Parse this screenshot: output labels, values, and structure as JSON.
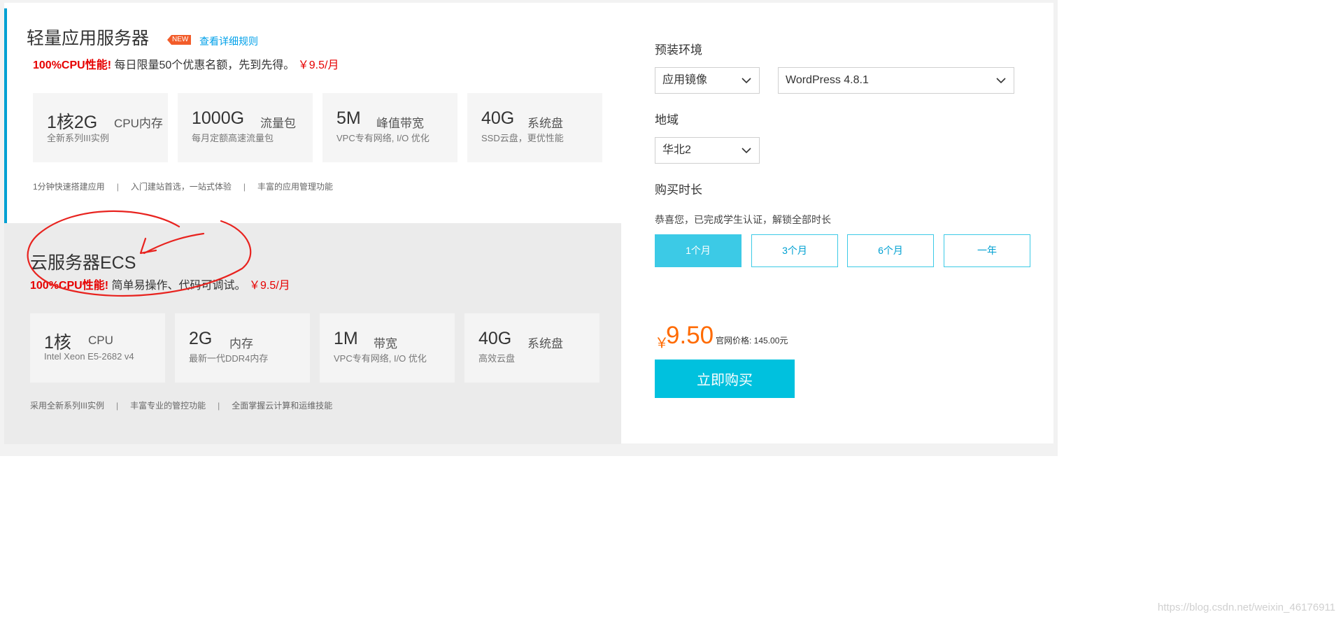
{
  "lightweight": {
    "title": "轻量应用服务器",
    "badge": "NEW",
    "rule_link": "查看详细规则",
    "promo_highlight": "100%CPU性能!",
    "promo_text": "每日限量50个优惠名额，先到先得。",
    "promo_price": "￥9.5/月",
    "specs": [
      {
        "big": "1核2G",
        "unit": "CPU内存",
        "desc": "全新系列III实例"
      },
      {
        "big": "1000G",
        "unit": "流量包",
        "desc": "每月定额高速流量包"
      },
      {
        "big": "5M",
        "unit": "峰值带宽",
        "desc": "VPC专有网络, I/O 优化"
      },
      {
        "big": "40G",
        "unit": "系统盘",
        "desc": "SSD云盘，更优性能"
      }
    ],
    "features": [
      "1分钟快速搭建应用",
      "入门建站首选，一站式体验",
      "丰富的应用管理功能"
    ],
    "feature_separator": "|"
  },
  "ecs": {
    "title": "云服务器ECS",
    "promo_highlight": "100%CPU性能!",
    "promo_text": "简单易操作、代码可调试。",
    "promo_price": "￥9.5/月",
    "specs": [
      {
        "big": "1核",
        "unit": "CPU",
        "desc": "Intel Xeon E5-2682 v4"
      },
      {
        "big": "2G",
        "unit": "内存",
        "desc": "最新一代DDR4内存"
      },
      {
        "big": "1M",
        "unit": "带宽",
        "desc": "VPC专有网络, I/O 优化"
      },
      {
        "big": "40G",
        "unit": "系统盘",
        "desc": "高效云盘"
      }
    ],
    "features": [
      "采用全新系列III实例",
      "丰富专业的管控功能",
      "全面掌握云计算和运维技能"
    ],
    "feature_separator": "|"
  },
  "config": {
    "preinstall_label": "预装环境",
    "image_type": "应用镜像",
    "image_version": "WordPress 4.8.1",
    "region_label": "地域",
    "region": "华北2",
    "duration_label": "购买时长",
    "student_notice": "恭喜您，已完成学生认证，解锁全部时长",
    "durations": [
      "1个月",
      "3个月",
      "6个月",
      "一年"
    ],
    "currency": "￥",
    "amount": "9.50",
    "official_price": "官网价格: 145.00元",
    "buy_label": "立即购买"
  },
  "watermark": "https://blog.csdn.net/weixin_46176911",
  "colors": {
    "accent": "#00c1de",
    "duration_active": "#3ccae6",
    "price": "#ff6a00",
    "promo_red": "#e60000",
    "link": "#00a0e9",
    "badge": "#f25c2a",
    "annotation": "#e8231f"
  }
}
